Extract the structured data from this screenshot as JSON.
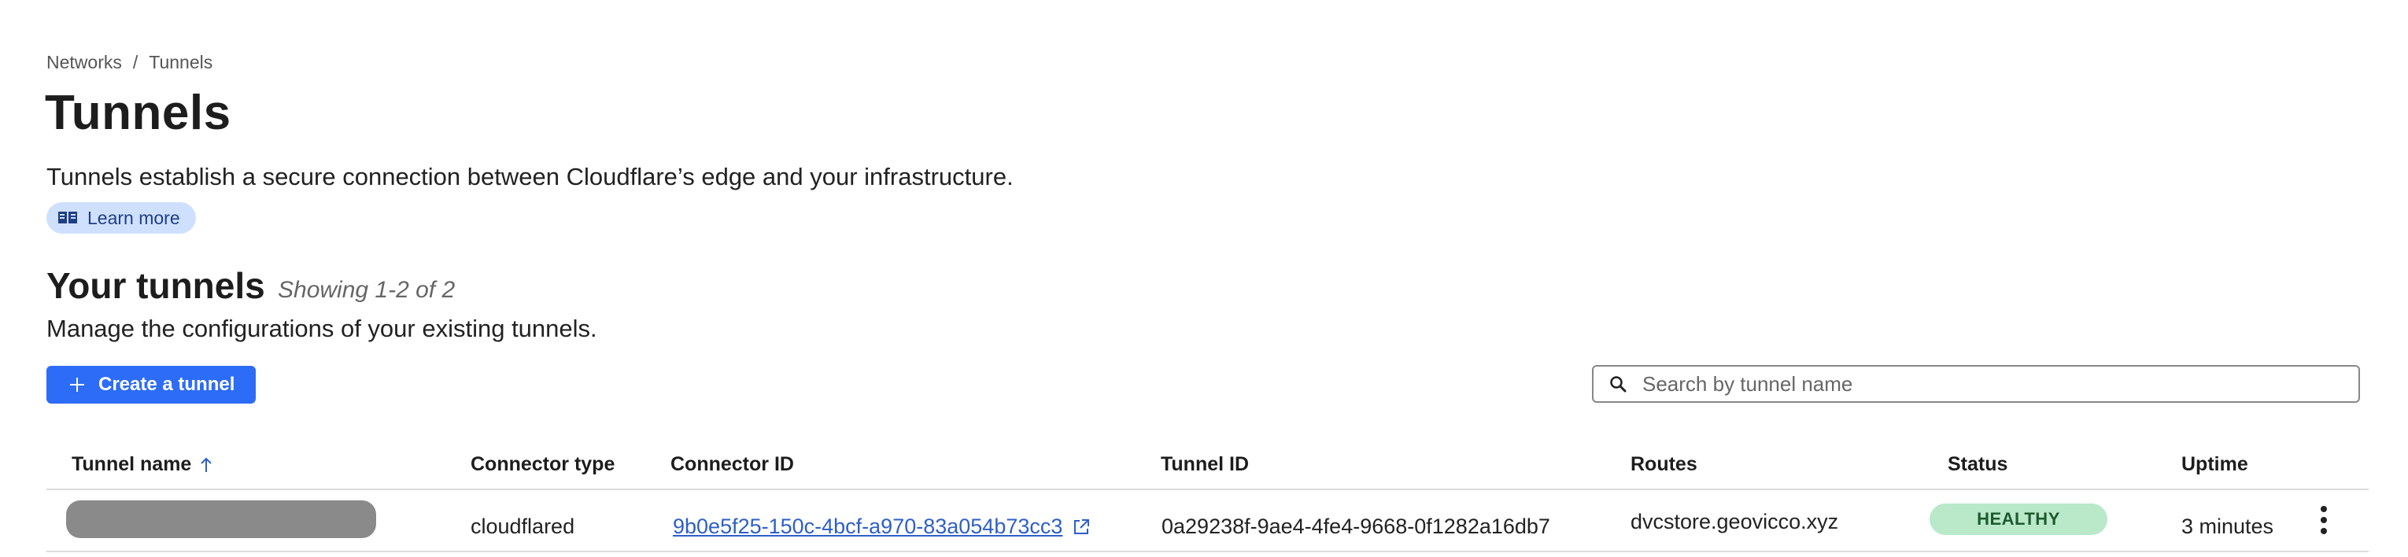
{
  "breadcrumb": {
    "items": [
      "Networks",
      "Tunnels"
    ],
    "separator": "/"
  },
  "header": {
    "title": "Tunnels",
    "description": "Tunnels establish a secure connection between Cloudflare’s edge and your infrastructure.",
    "learn_more_label": "Learn more",
    "learn_more_icon": "book-icon"
  },
  "section": {
    "title": "Your tunnels",
    "showing": "Showing 1-2 of 2",
    "description": "Manage the configurations of your existing tunnels."
  },
  "toolbar": {
    "create_label": "Create a tunnel",
    "create_icon": "plus-icon",
    "search_placeholder": "Search by tunnel name",
    "search_value": "",
    "search_icon": "search-icon"
  },
  "table": {
    "columns": {
      "tunnel_name": "Tunnel name",
      "connector_type": "Connector type",
      "connector_id": "Connector ID",
      "tunnel_id": "Tunnel ID",
      "routes": "Routes",
      "status": "Status",
      "uptime": "Uptime"
    },
    "sort_icon": "arrow-up-icon",
    "rows": [
      {
        "tunnel_name": "",
        "connector_type": "cloudflared",
        "connector_id": "9b0e5f25-150c-4bcf-a970-83a054b73cc3",
        "tunnel_id": "0a29238f-9ae4-4fe4-9668-0f1282a16db7",
        "routes": "dvcstore.geovicco.xyz",
        "status": "HEALTHY",
        "uptime": "3 minutes"
      }
    ]
  },
  "colors": {
    "primary": "#2d6cf6",
    "link": "#2d5fc8",
    "healthy_bg": "#b9e9c9",
    "learn_more_bg": "#cfe0ff"
  }
}
